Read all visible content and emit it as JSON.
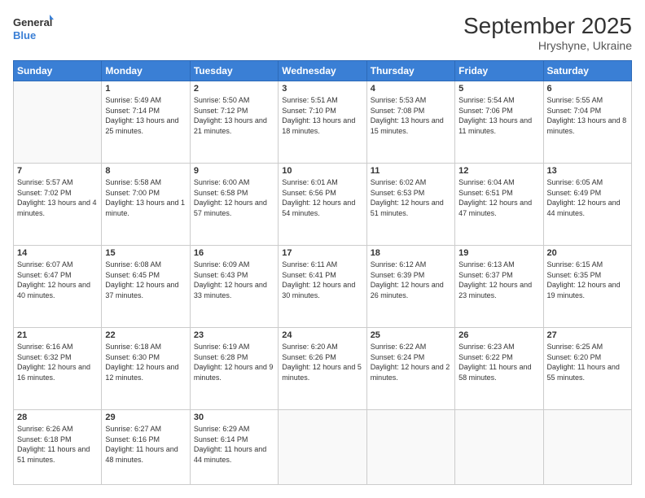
{
  "logo": {
    "line1": "General",
    "line2": "Blue"
  },
  "title": "September 2025",
  "subtitle": "Hryshyne, Ukraine",
  "days_of_week": [
    "Sunday",
    "Monday",
    "Tuesday",
    "Wednesday",
    "Thursday",
    "Friday",
    "Saturday"
  ],
  "weeks": [
    [
      {
        "day": "",
        "info": ""
      },
      {
        "day": "1",
        "info": "Sunrise: 5:49 AM\nSunset: 7:14 PM\nDaylight: 13 hours and 25 minutes."
      },
      {
        "day": "2",
        "info": "Sunrise: 5:50 AM\nSunset: 7:12 PM\nDaylight: 13 hours and 21 minutes."
      },
      {
        "day": "3",
        "info": "Sunrise: 5:51 AM\nSunset: 7:10 PM\nDaylight: 13 hours and 18 minutes."
      },
      {
        "day": "4",
        "info": "Sunrise: 5:53 AM\nSunset: 7:08 PM\nDaylight: 13 hours and 15 minutes."
      },
      {
        "day": "5",
        "info": "Sunrise: 5:54 AM\nSunset: 7:06 PM\nDaylight: 13 hours and 11 minutes."
      },
      {
        "day": "6",
        "info": "Sunrise: 5:55 AM\nSunset: 7:04 PM\nDaylight: 13 hours and 8 minutes."
      }
    ],
    [
      {
        "day": "7",
        "info": "Sunrise: 5:57 AM\nSunset: 7:02 PM\nDaylight: 13 hours and 4 minutes."
      },
      {
        "day": "8",
        "info": "Sunrise: 5:58 AM\nSunset: 7:00 PM\nDaylight: 13 hours and 1 minute."
      },
      {
        "day": "9",
        "info": "Sunrise: 6:00 AM\nSunset: 6:58 PM\nDaylight: 12 hours and 57 minutes."
      },
      {
        "day": "10",
        "info": "Sunrise: 6:01 AM\nSunset: 6:56 PM\nDaylight: 12 hours and 54 minutes."
      },
      {
        "day": "11",
        "info": "Sunrise: 6:02 AM\nSunset: 6:53 PM\nDaylight: 12 hours and 51 minutes."
      },
      {
        "day": "12",
        "info": "Sunrise: 6:04 AM\nSunset: 6:51 PM\nDaylight: 12 hours and 47 minutes."
      },
      {
        "day": "13",
        "info": "Sunrise: 6:05 AM\nSunset: 6:49 PM\nDaylight: 12 hours and 44 minutes."
      }
    ],
    [
      {
        "day": "14",
        "info": "Sunrise: 6:07 AM\nSunset: 6:47 PM\nDaylight: 12 hours and 40 minutes."
      },
      {
        "day": "15",
        "info": "Sunrise: 6:08 AM\nSunset: 6:45 PM\nDaylight: 12 hours and 37 minutes."
      },
      {
        "day": "16",
        "info": "Sunrise: 6:09 AM\nSunset: 6:43 PM\nDaylight: 12 hours and 33 minutes."
      },
      {
        "day": "17",
        "info": "Sunrise: 6:11 AM\nSunset: 6:41 PM\nDaylight: 12 hours and 30 minutes."
      },
      {
        "day": "18",
        "info": "Sunrise: 6:12 AM\nSunset: 6:39 PM\nDaylight: 12 hours and 26 minutes."
      },
      {
        "day": "19",
        "info": "Sunrise: 6:13 AM\nSunset: 6:37 PM\nDaylight: 12 hours and 23 minutes."
      },
      {
        "day": "20",
        "info": "Sunrise: 6:15 AM\nSunset: 6:35 PM\nDaylight: 12 hours and 19 minutes."
      }
    ],
    [
      {
        "day": "21",
        "info": "Sunrise: 6:16 AM\nSunset: 6:32 PM\nDaylight: 12 hours and 16 minutes."
      },
      {
        "day": "22",
        "info": "Sunrise: 6:18 AM\nSunset: 6:30 PM\nDaylight: 12 hours and 12 minutes."
      },
      {
        "day": "23",
        "info": "Sunrise: 6:19 AM\nSunset: 6:28 PM\nDaylight: 12 hours and 9 minutes."
      },
      {
        "day": "24",
        "info": "Sunrise: 6:20 AM\nSunset: 6:26 PM\nDaylight: 12 hours and 5 minutes."
      },
      {
        "day": "25",
        "info": "Sunrise: 6:22 AM\nSunset: 6:24 PM\nDaylight: 12 hours and 2 minutes."
      },
      {
        "day": "26",
        "info": "Sunrise: 6:23 AM\nSunset: 6:22 PM\nDaylight: 11 hours and 58 minutes."
      },
      {
        "day": "27",
        "info": "Sunrise: 6:25 AM\nSunset: 6:20 PM\nDaylight: 11 hours and 55 minutes."
      }
    ],
    [
      {
        "day": "28",
        "info": "Sunrise: 6:26 AM\nSunset: 6:18 PM\nDaylight: 11 hours and 51 minutes."
      },
      {
        "day": "29",
        "info": "Sunrise: 6:27 AM\nSunset: 6:16 PM\nDaylight: 11 hours and 48 minutes."
      },
      {
        "day": "30",
        "info": "Sunrise: 6:29 AM\nSunset: 6:14 PM\nDaylight: 11 hours and 44 minutes."
      },
      {
        "day": "",
        "info": ""
      },
      {
        "day": "",
        "info": ""
      },
      {
        "day": "",
        "info": ""
      },
      {
        "day": "",
        "info": ""
      }
    ]
  ]
}
